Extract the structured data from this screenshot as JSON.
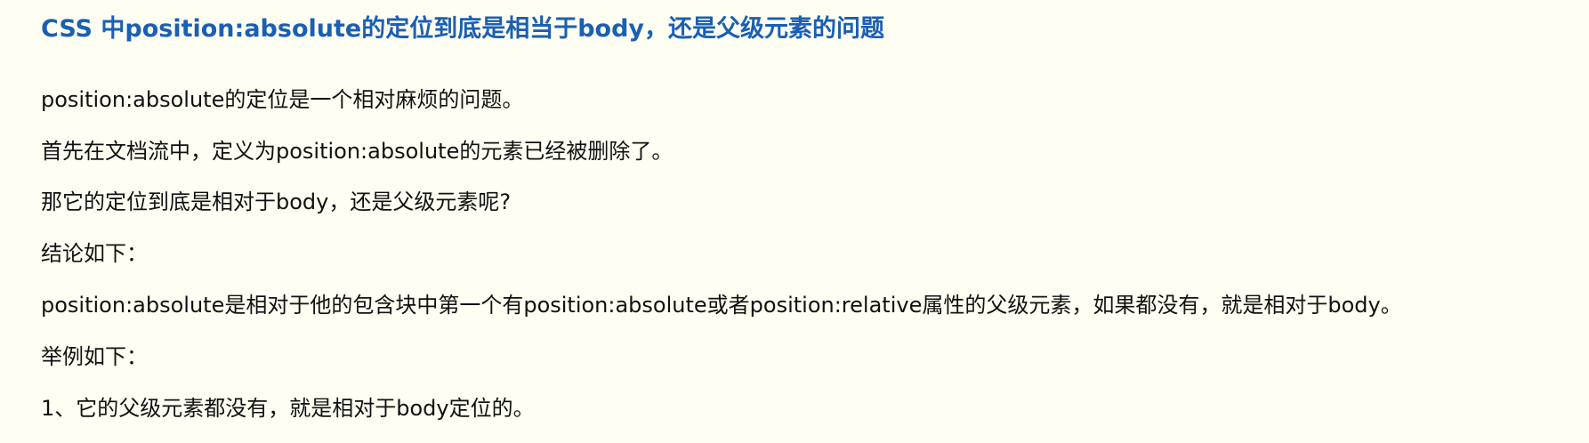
{
  "article": {
    "title": "CSS 中position:absolute的定位到底是相当于body，还是父级元素的问题",
    "paragraphs": [
      "position:absolute的定位是一个相对麻烦的问题。",
      "首先在文档流中，定义为position:absolute的元素已经被删除了。",
      "那它的定位到底是相对于body，还是父级元素呢?",
      "结论如下：",
      "position:absolute是相对于他的包含块中第一个有position:absolute或者position:relative属性的父级元素，如果都没有，就是相对于body。",
      "举例如下：",
      "1、它的父级元素都没有，就是相对于body定位的。"
    ]
  },
  "colors": {
    "background": "#fffef3",
    "title": "#1a5fb4",
    "text": "#111111"
  }
}
